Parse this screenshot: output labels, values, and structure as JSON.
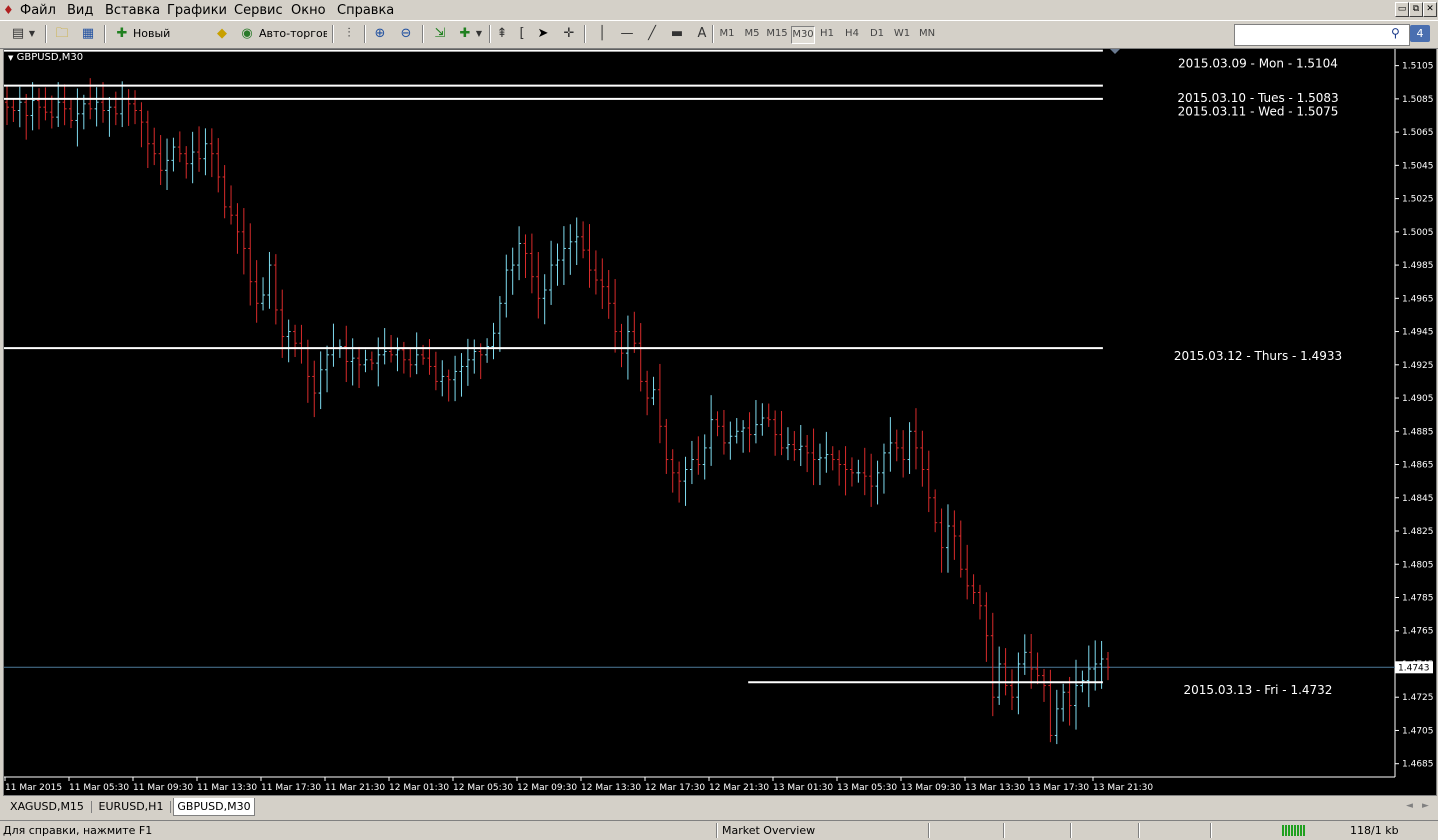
{
  "menu": {
    "items": [
      "Файл",
      "Вид",
      "Вставка",
      "Графики",
      "Сервис",
      "Окно",
      "Справка"
    ],
    "window_buttons": [
      "▭",
      "⧉",
      "✕"
    ]
  },
  "toolbar": {
    "new_order_label": "Новый Ордер",
    "autotrade_label": "Авто-торговля",
    "timeframes": [
      "M1",
      "M5",
      "M15",
      "M30",
      "H1",
      "H4",
      "D1",
      "W1",
      "MN"
    ],
    "active_timeframe": "M30",
    "notifications_count": "4",
    "search_value": ""
  },
  "chart_title": "GBPUSD,M30",
  "current_price_label": "1.4743",
  "status": {
    "help": "Для справки, нажмите F1",
    "profile": "Market Overview",
    "traffic": "118/1 kb"
  },
  "tabs": [
    "XAGUSD,M15",
    "EURUSD,H1",
    "GBPUSD,M30"
  ],
  "active_tab": "GBPUSD,M30",
  "colors": {
    "bg": "#000000",
    "bull": "#7fdcf0",
    "bear": "#d92b2b",
    "level": "#ffffff",
    "axis": "#ffffff",
    "price_line": "#4d7a9a"
  },
  "chart_data": {
    "type": "ohlc",
    "symbol": "GBPUSD",
    "timeframe": "M30",
    "ylim": [
      1.4677,
      1.5115
    ],
    "y_ticks": [
      "1.5105",
      "1.5085",
      "1.5065",
      "1.5045",
      "1.5025",
      "1.5005",
      "1.4985",
      "1.4965",
      "1.4945",
      "1.4925",
      "1.4905",
      "1.4885",
      "1.4865",
      "1.4845",
      "1.4825",
      "1.4805",
      "1.4785",
      "1.4765",
      "1.4745",
      "1.4725",
      "1.4705",
      "1.4685"
    ],
    "x_ticks": [
      "11 Mar 2015",
      "11 Mar 05:30",
      "11 Mar 09:30",
      "11 Mar 13:30",
      "11 Mar 17:30",
      "11 Mar 21:30",
      "12 Mar 01:30",
      "12 Mar 05:30",
      "12 Mar 09:30",
      "12 Mar 13:30",
      "12 Mar 17:30",
      "12 Mar 21:30",
      "13 Mar 01:30",
      "13 Mar 05:30",
      "13 Mar 09:30",
      "13 Mar 13:30",
      "13 Mar 17:30",
      "13 Mar 21:30"
    ],
    "current_price": 1.4743,
    "levels": [
      {
        "price": 1.5114,
        "label": "2015.03.09 - Mon - 1.5104",
        "label_price": 1.5104,
        "x_start": 0,
        "x_end": 0.79
      },
      {
        "price": 1.5093,
        "label": "2015.03.10 - Tues - 1.5083",
        "label_price": 1.5083,
        "x_start": 0,
        "x_end": 0.79
      },
      {
        "price": 1.5085,
        "label": "2015.03.11 - Wed - 1.5075",
        "label_price": 1.5075,
        "x_start": 0,
        "x_end": 0.79
      },
      {
        "price": 1.4935,
        "label": "2015.03.12 - Thurs - 1.4933",
        "label_price": 1.4928,
        "x_start": 0,
        "x_end": 0.79
      },
      {
        "price": 1.4734,
        "label": "2015.03.13 - Fri - 1.4732",
        "label_price": 1.4727,
        "x_start": 0.535,
        "x_end": 0.79
      }
    ],
    "closes": [
      1.508,
      1.5078,
      1.5083,
      1.5075,
      1.5084,
      1.508,
      1.5077,
      1.5074,
      1.5083,
      1.5079,
      1.5072,
      1.5076,
      1.5082,
      1.5079,
      1.5083,
      1.5078,
      1.508,
      1.5076,
      1.5085,
      1.5082,
      1.5078,
      1.5071,
      1.5058,
      1.5052,
      1.5042,
      1.5048,
      1.5056,
      1.5052,
      1.5046,
      1.5053,
      1.5049,
      1.5058,
      1.5052,
      1.5038,
      1.502,
      1.5015,
      1.5005,
      1.4995,
      1.4975,
      1.4962,
      1.4967,
      1.4985,
      1.4958,
      1.4942,
      1.4945,
      1.4938,
      1.4935,
      1.4918,
      1.4908,
      1.4922,
      1.4931,
      1.4935,
      1.4936,
      1.4927,
      1.4929,
      1.4925,
      1.4928,
      1.4926,
      1.4931,
      1.4933,
      1.4931,
      1.4934,
      1.4928,
      1.4925,
      1.4931,
      1.4929,
      1.4924,
      1.4915,
      1.4918,
      1.4916,
      1.4921,
      1.4924,
      1.4928,
      1.4933,
      1.4931,
      1.4936,
      1.4944,
      1.4962,
      1.4982,
      1.4985,
      1.4998,
      1.4992,
      1.4978,
      1.4965,
      1.497,
      1.4985,
      1.4988,
      1.4995,
      1.4999,
      1.5002,
      1.4994,
      1.4982,
      1.4976,
      1.4972,
      1.4962,
      1.4945,
      1.4932,
      1.4945,
      1.4938,
      1.4915,
      1.4905,
      1.491,
      1.4888,
      1.4868,
      1.486,
      1.4855,
      1.4862,
      1.4868,
      1.4865,
      1.4875,
      1.4892,
      1.4888,
      1.4878,
      1.4882,
      1.4885,
      1.4887,
      1.4883,
      1.4889,
      1.4893,
      1.4892,
      1.4883,
      1.4875,
      1.4877,
      1.4874,
      1.4876,
      1.4872,
      1.4868,
      1.4869,
      1.4871,
      1.4868,
      1.4865,
      1.4862,
      1.486,
      1.486,
      1.4858,
      1.4852,
      1.486,
      1.4872,
      1.4878,
      1.4875,
      1.4868,
      1.4885,
      1.4875,
      1.4862,
      1.4845,
      1.483,
      1.4815,
      1.4828,
      1.4822,
      1.4802,
      1.4792,
      1.4788,
      1.478,
      1.4762,
      1.4725,
      1.4745,
      1.4732,
      1.4725,
      1.4745,
      1.4752,
      1.4742,
      1.4738,
      1.4732,
      1.4702,
      1.4718,
      1.4728,
      1.472,
      1.4732,
      1.4735,
      1.4742,
      1.4745,
      1.4748,
      1.4743
    ]
  }
}
